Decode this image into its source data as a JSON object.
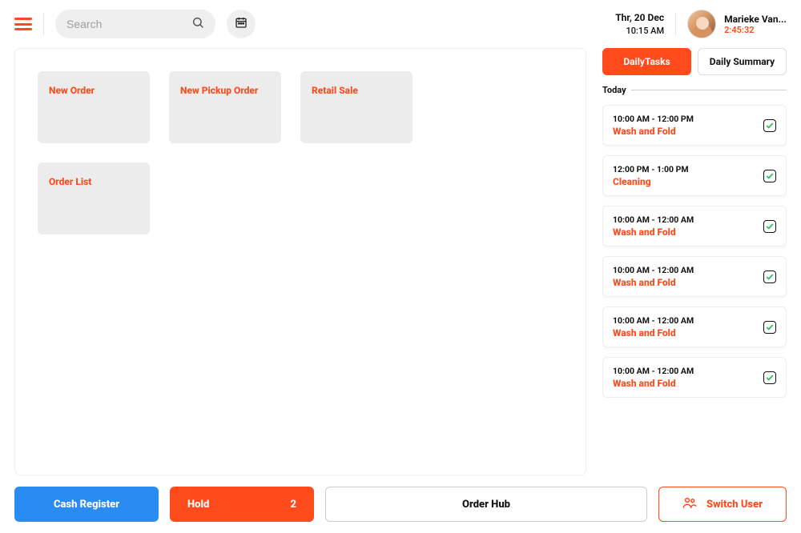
{
  "header": {
    "search_placeholder": "Search",
    "date": "Thr, 20 Dec",
    "time": "10:15 AM",
    "user_name": "Marieke Van...",
    "session_timer": "2:45:32"
  },
  "main": {
    "cards": [
      {
        "id": "new-order",
        "label": "New Order"
      },
      {
        "id": "new-pickup-order",
        "label": "New Pickup Order"
      },
      {
        "id": "retail-sale",
        "label": "Retail Sale"
      },
      {
        "id": "order-list",
        "label": "Order List"
      }
    ]
  },
  "sidebar": {
    "tab_daily_tasks": "DailyTasks",
    "tab_daily_summary": "Daily Summary",
    "today_label": "Today",
    "tasks": [
      {
        "time": "10:00 AM - 12:00 PM",
        "title": "Wash and Fold",
        "done": true
      },
      {
        "time": "12:00 PM - 1:00 PM",
        "title": "Cleaning",
        "done": true
      },
      {
        "time": "10:00 AM - 12:00 AM",
        "title": "Wash and Fold",
        "done": true
      },
      {
        "time": "10:00 AM - 12:00 AM",
        "title": "Wash and Fold",
        "done": true
      },
      {
        "time": "10:00 AM - 12:00 AM",
        "title": "Wash and Fold",
        "done": true
      },
      {
        "time": "10:00 AM - 12:00 AM",
        "title": "Wash and Fold",
        "done": true
      }
    ]
  },
  "footer": {
    "cash_register": "Cash Register",
    "hold": "Hold",
    "hold_count": "2",
    "order_hub": "Order Hub",
    "switch_user": "Switch User"
  },
  "colors": {
    "accent": "#ff4a1c",
    "primary_blue": "#2a8bf2"
  }
}
